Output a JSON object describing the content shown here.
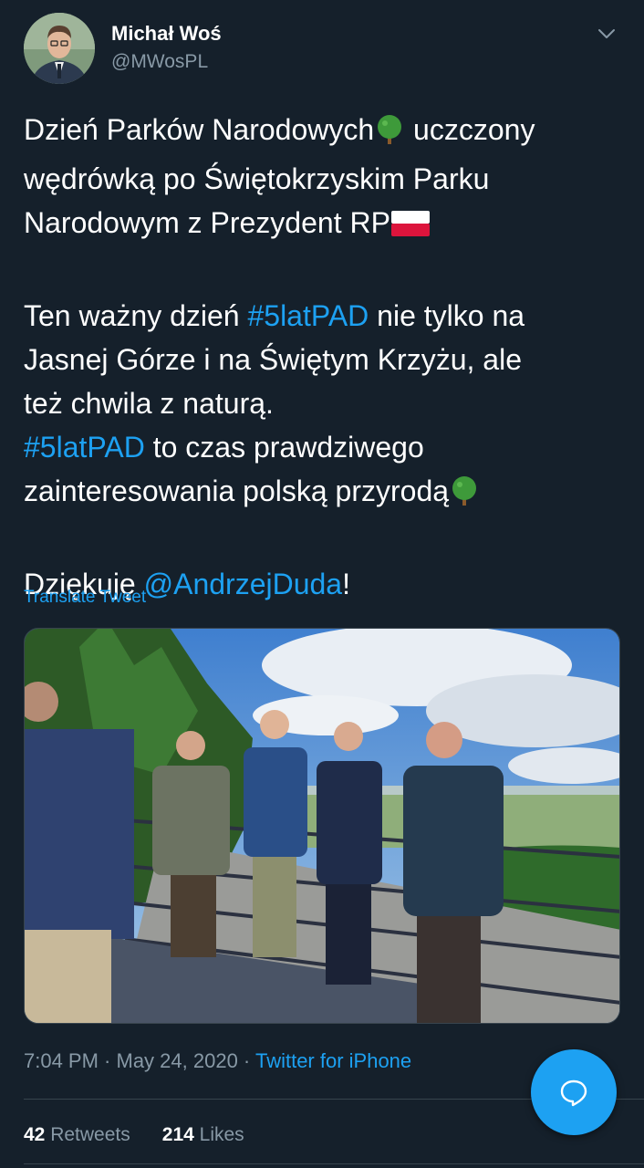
{
  "tweet": {
    "author_name": "Michał Woś",
    "author_handle": "@MWosPL",
    "line1": "Dzień Parków Narodowych",
    "line1_tail": " uczczony",
    "line2": "wędrówką po Świętokrzyskim Parku",
    "line3": "Narodowym z Prezydent RP",
    "p2_pre": "Ten ważny dzień ",
    "hashtag1": "#5latPAD",
    "p2_post": " nie tylko na",
    "p2_line2": "Jasnej Górze i na Świętym Krzyżu, ale",
    "p2_line3": "też chwila z naturą.",
    "hashtag2": "#5latPAD",
    "p3_post": " to czas prawdziwego",
    "p3_line2": "zainteresowania polską przyrodą",
    "thanks_pre": "Dziękuję ",
    "mention": "@AndrzejDuda",
    "thanks_post": "!",
    "translate_label": "Translate Tweet",
    "time": "7:04 PM",
    "separator": " · ",
    "date": "May 24, 2020",
    "source": "Twitter for iPhone",
    "retweets_count": "42",
    "retweets_label": "Retweets",
    "likes_count": "214",
    "likes_label": "Likes"
  },
  "icons": {
    "menu": "chevron-down-icon",
    "tree": "deciduous-tree-emoji",
    "flag": "flag-poland-emoji",
    "compose": "reply-bubble-icon"
  },
  "colors": {
    "background": "#15202b",
    "accent": "#1da1f2",
    "secondary_text": "#8899a6",
    "divider": "#38444d"
  }
}
